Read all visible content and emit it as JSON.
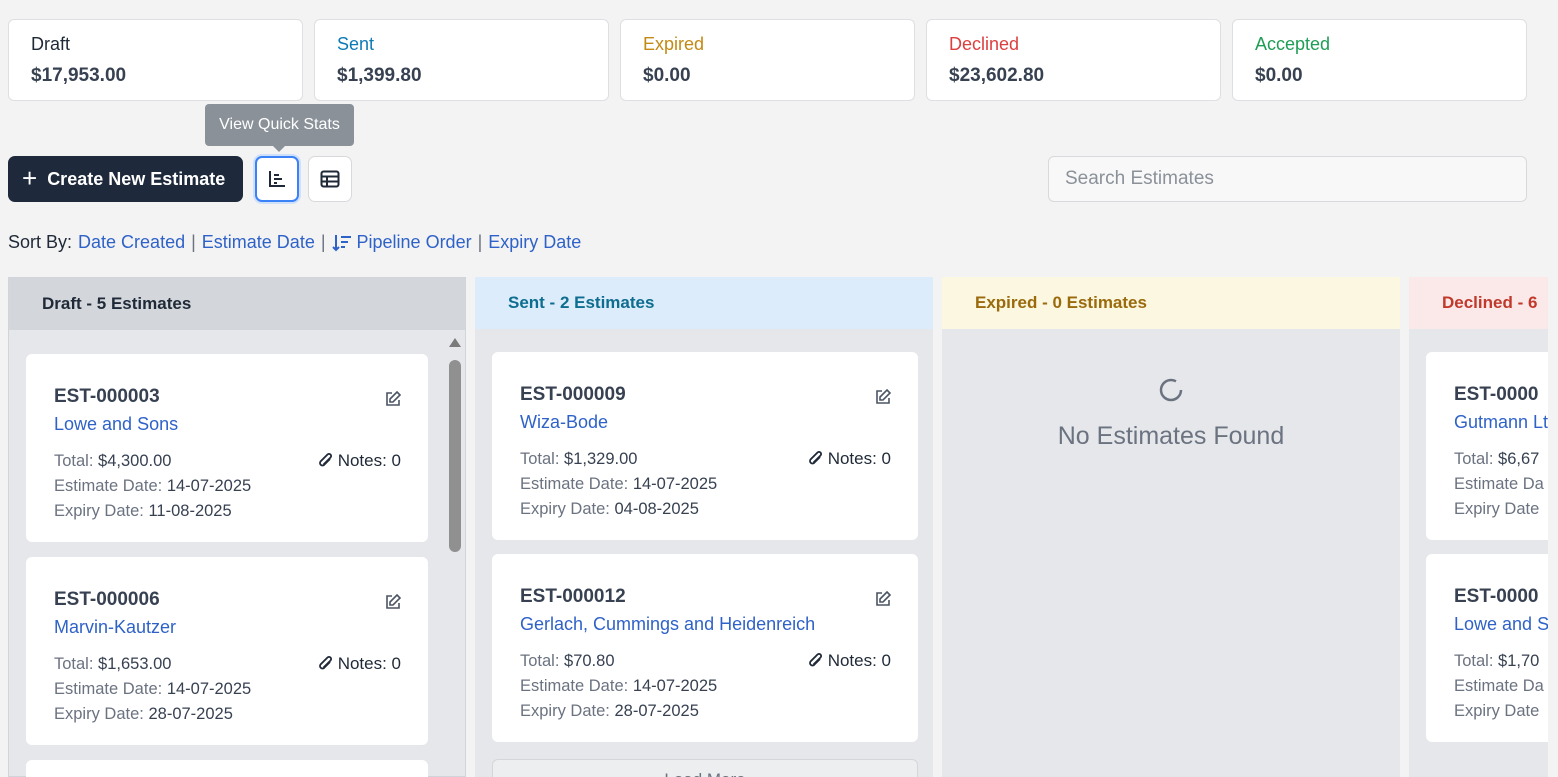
{
  "stats": [
    {
      "label": "Draft",
      "amount": "$17,953.00",
      "color": "#1f2937"
    },
    {
      "label": "Sent",
      "amount": "$1,399.80",
      "color": "#0e7ab5"
    },
    {
      "label": "Expired",
      "amount": "$0.00",
      "color": "#c28a14"
    },
    {
      "label": "Declined",
      "amount": "$23,602.80",
      "color": "#dc3f3f"
    },
    {
      "label": "Accepted",
      "amount": "$0.00",
      "color": "#1f9d55"
    }
  ],
  "tooltip": "View Quick Stats",
  "toolbar": {
    "create_plus": "+",
    "create_label": "Create New Estimate",
    "search_placeholder": "Search Estimates"
  },
  "sort": {
    "lead": "Sort By:",
    "date_created": "Date Created",
    "estimate_date": "Estimate Date",
    "pipeline_order": "Pipeline Order",
    "expiry_date": "Expiry Date",
    "separator": "|"
  },
  "columns": {
    "draft": {
      "title": "Draft - 5 Estimates",
      "color": "#1f2937",
      "bg": "#d3d6db"
    },
    "sent": {
      "title": "Sent - 2 Estimates",
      "color": "#0d6e8f",
      "bg": "#dcecfb"
    },
    "expired": {
      "title": "Expired - 0 Estimates",
      "color": "#9a6a0c",
      "bg": "#fbf7e0"
    },
    "declined": {
      "title": "Declined - 6",
      "color": "#c0392b",
      "bg": "#fbe9e9"
    }
  },
  "labels": {
    "total": "Total:",
    "estimate_date": "Estimate Date:",
    "expiry_date": "Expiry Date:",
    "estimate_date_cut": "Estimate Da",
    "expiry_date_cut": "Expiry Date"
  },
  "cards": {
    "draft": [
      {
        "num": "EST-000003",
        "client": "Lowe and Sons",
        "total": "$4,300.00",
        "estimate_date": "14-07-2025",
        "expiry_date": "11-08-2025",
        "notes": "Notes: 0"
      },
      {
        "num": "EST-000006",
        "client": "Marvin-Kautzer",
        "total": "$1,653.00",
        "estimate_date": "14-07-2025",
        "expiry_date": "28-07-2025",
        "notes": "Notes: 0"
      }
    ],
    "sent": [
      {
        "num": "EST-000009",
        "client": "Wiza-Bode",
        "total": "$1,329.00",
        "estimate_date": "14-07-2025",
        "expiry_date": "04-08-2025",
        "notes": "Notes: 0"
      },
      {
        "num": "EST-000012",
        "client": "Gerlach, Cummings and Heidenreich",
        "total": "$70.80",
        "estimate_date": "14-07-2025",
        "expiry_date": "28-07-2025",
        "notes": "Notes: 0"
      }
    ],
    "declined": [
      {
        "num": "EST-0000",
        "client": "Gutmann Lt",
        "total": "$6,67"
      },
      {
        "num": "EST-0000",
        "client": "Lowe and S",
        "total": "$1,70"
      }
    ]
  },
  "expired_empty": "No Estimates Found",
  "load_more": "Load More"
}
